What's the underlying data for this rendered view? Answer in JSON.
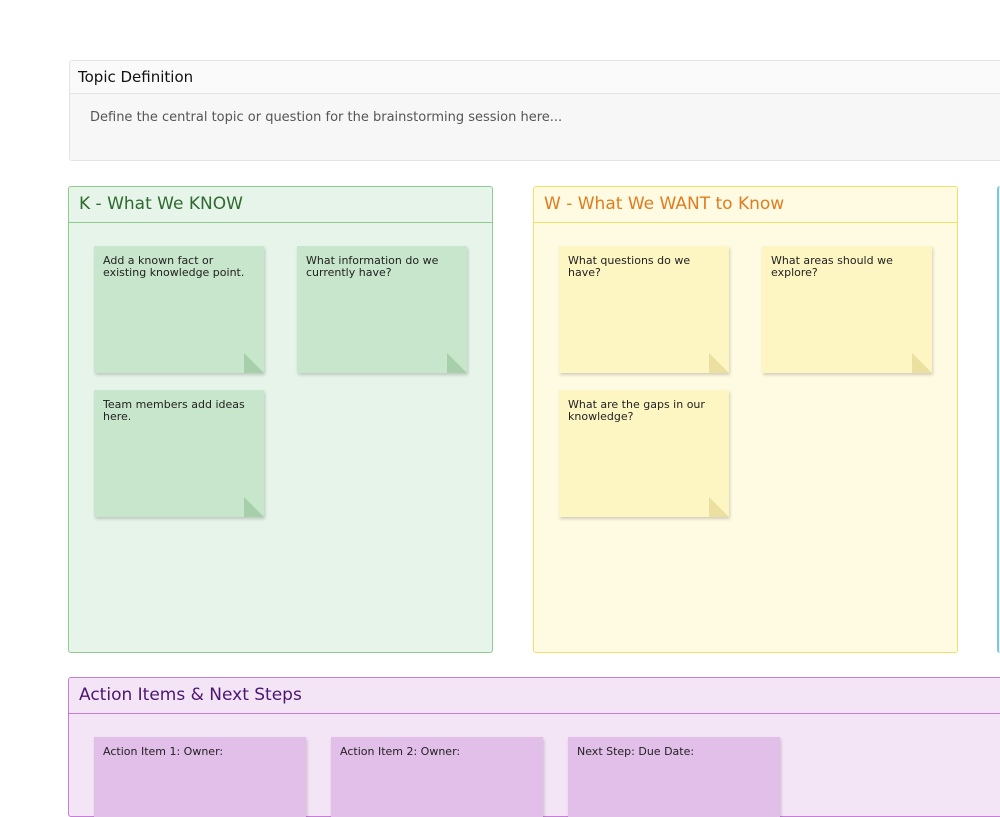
{
  "topic": {
    "title": "Topic Definition",
    "placeholder": "Define the central topic or question for the brainstorming session here..."
  },
  "know": {
    "title": "K - What We KNOW",
    "notes": [
      "Add a known fact or existing knowledge point.",
      "What information do we currently have?",
      "Team members add ideas here."
    ]
  },
  "want": {
    "title": "W - What We WANT to Know",
    "notes": [
      "What questions do we have?",
      "What areas should we explore?",
      "What are the gaps in our knowledge?"
    ]
  },
  "actions": {
    "title": "Action Items & Next Steps",
    "notes": [
      "Action Item 1: Owner:",
      "Action Item 2: Owner:",
      "Next Step: Due Date:"
    ]
  },
  "colors": {
    "know": "#c8e6cb",
    "want": "#fdf6c2",
    "learned_edge": "#7fc4e0",
    "actions": "#e2bfe8"
  }
}
